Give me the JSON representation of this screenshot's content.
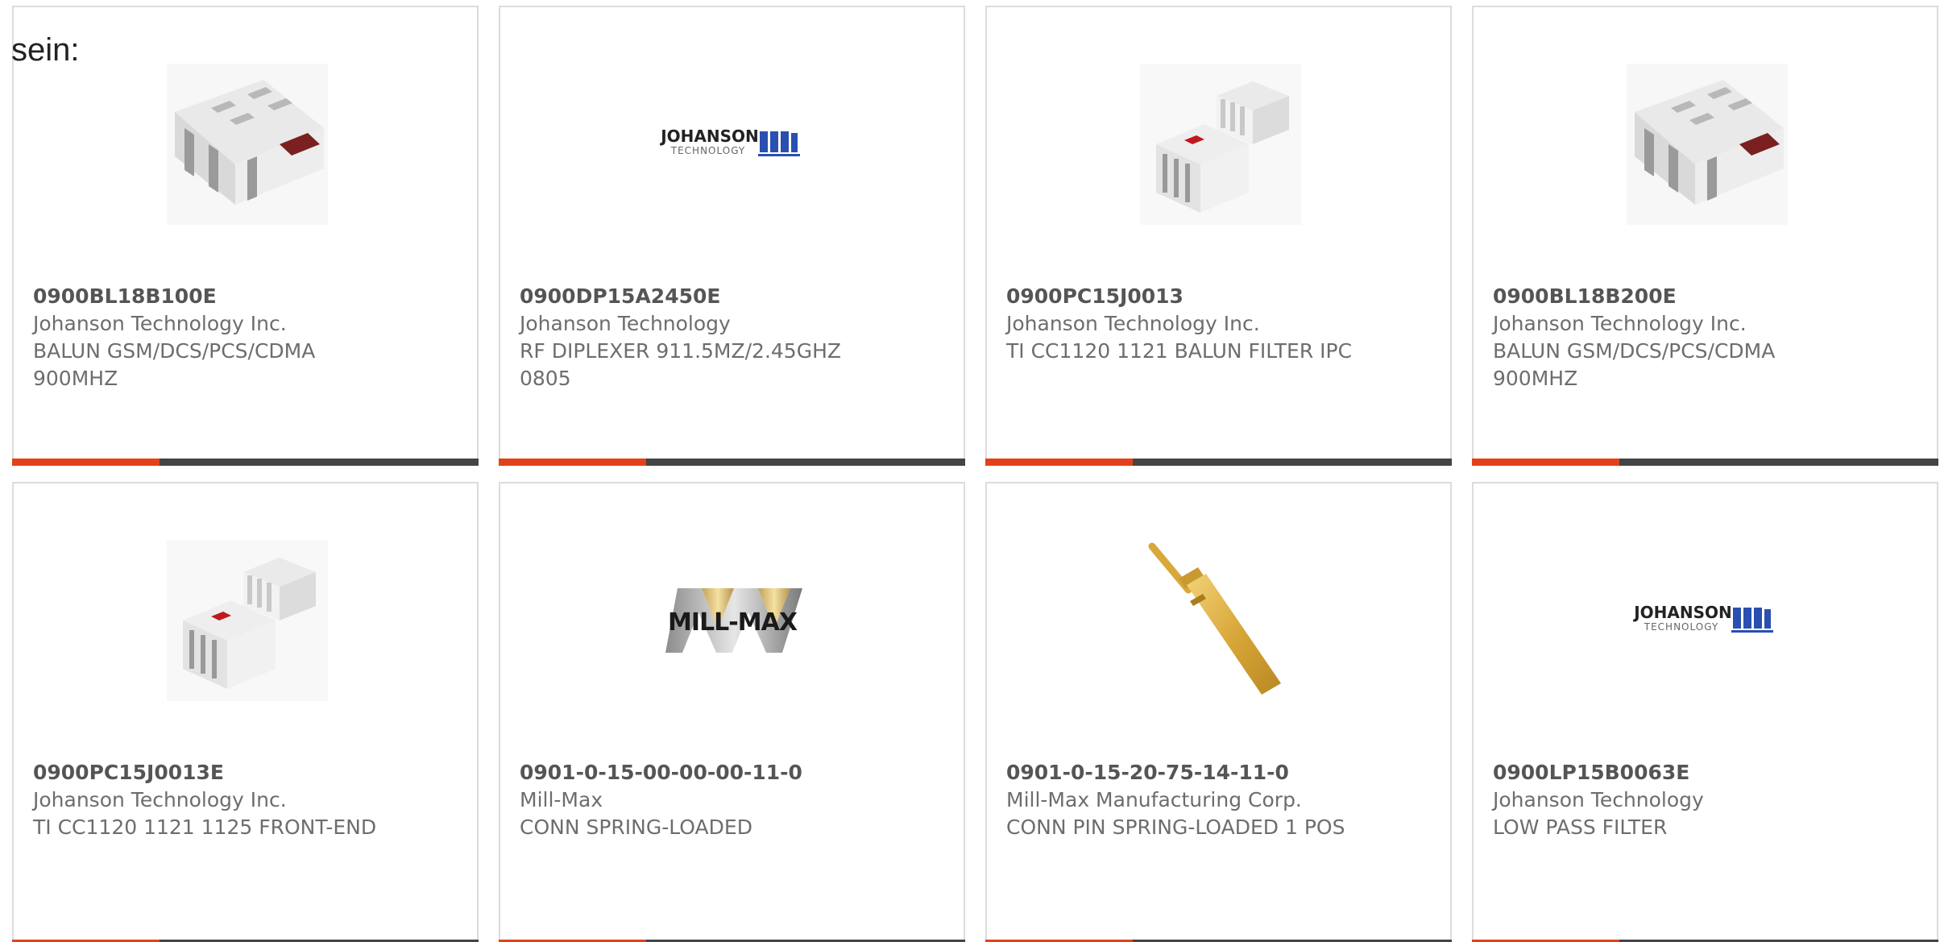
{
  "intro_text": "sein:",
  "products": [
    {
      "part_number": "0900BL18B100E",
      "manufacturer": "Johanson Technology Inc.",
      "description": "BALUN GSM/DCS/PCS/CDMA 900MHZ",
      "image": "balun-chip-image"
    },
    {
      "part_number": "0900DP15A2450E",
      "manufacturer": "Johanson Technology",
      "description": "RF DIPLEXER 911.5MZ/2.45GHZ 0805",
      "image": "johanson-technology-logo",
      "logo_line1": "JOHANSON",
      "logo_line2": "TECHNOLOGY"
    },
    {
      "part_number": "0900PC15J0013",
      "manufacturer": "Johanson Technology Inc.",
      "description": "TI CC1120 1121 BALUN FILTER IPC",
      "image": "balun-filter-pair-image"
    },
    {
      "part_number": "0900BL18B200E",
      "manufacturer": "Johanson Technology Inc.",
      "description": "BALUN GSM/DCS/PCS/CDMA 900MHZ",
      "image": "balun-chip-image"
    },
    {
      "part_number": "0900PC15J0013E",
      "manufacturer": "Johanson Technology Inc.",
      "description": "TI CC1120 1121 1125 FRONT-END",
      "image": "balun-filter-pair-image"
    },
    {
      "part_number": "0901-0-15-00-00-00-11-0",
      "manufacturer": "Mill-Max",
      "description": "CONN SPRING-LOADED",
      "image": "mill-max-logo",
      "logo_text": "MILL-MAX"
    },
    {
      "part_number": "0901-0-15-20-75-14-11-0",
      "manufacturer": "Mill-Max Manufacturing Corp.",
      "description": "CONN PIN SPRING-LOADED 1 POS",
      "image": "spring-pin-image"
    },
    {
      "part_number": "0900LP15B0063E",
      "manufacturer": "Johanson Technology",
      "description": "LOW PASS FILTER",
      "image": "johanson-technology-logo",
      "logo_line1": "JOHANSON",
      "logo_line2": "TECHNOLOGY"
    }
  ],
  "colors": {
    "accent": "#e2421b",
    "bar": "#444444",
    "border": "#dcdcdc",
    "text": "#6d6d6d"
  }
}
